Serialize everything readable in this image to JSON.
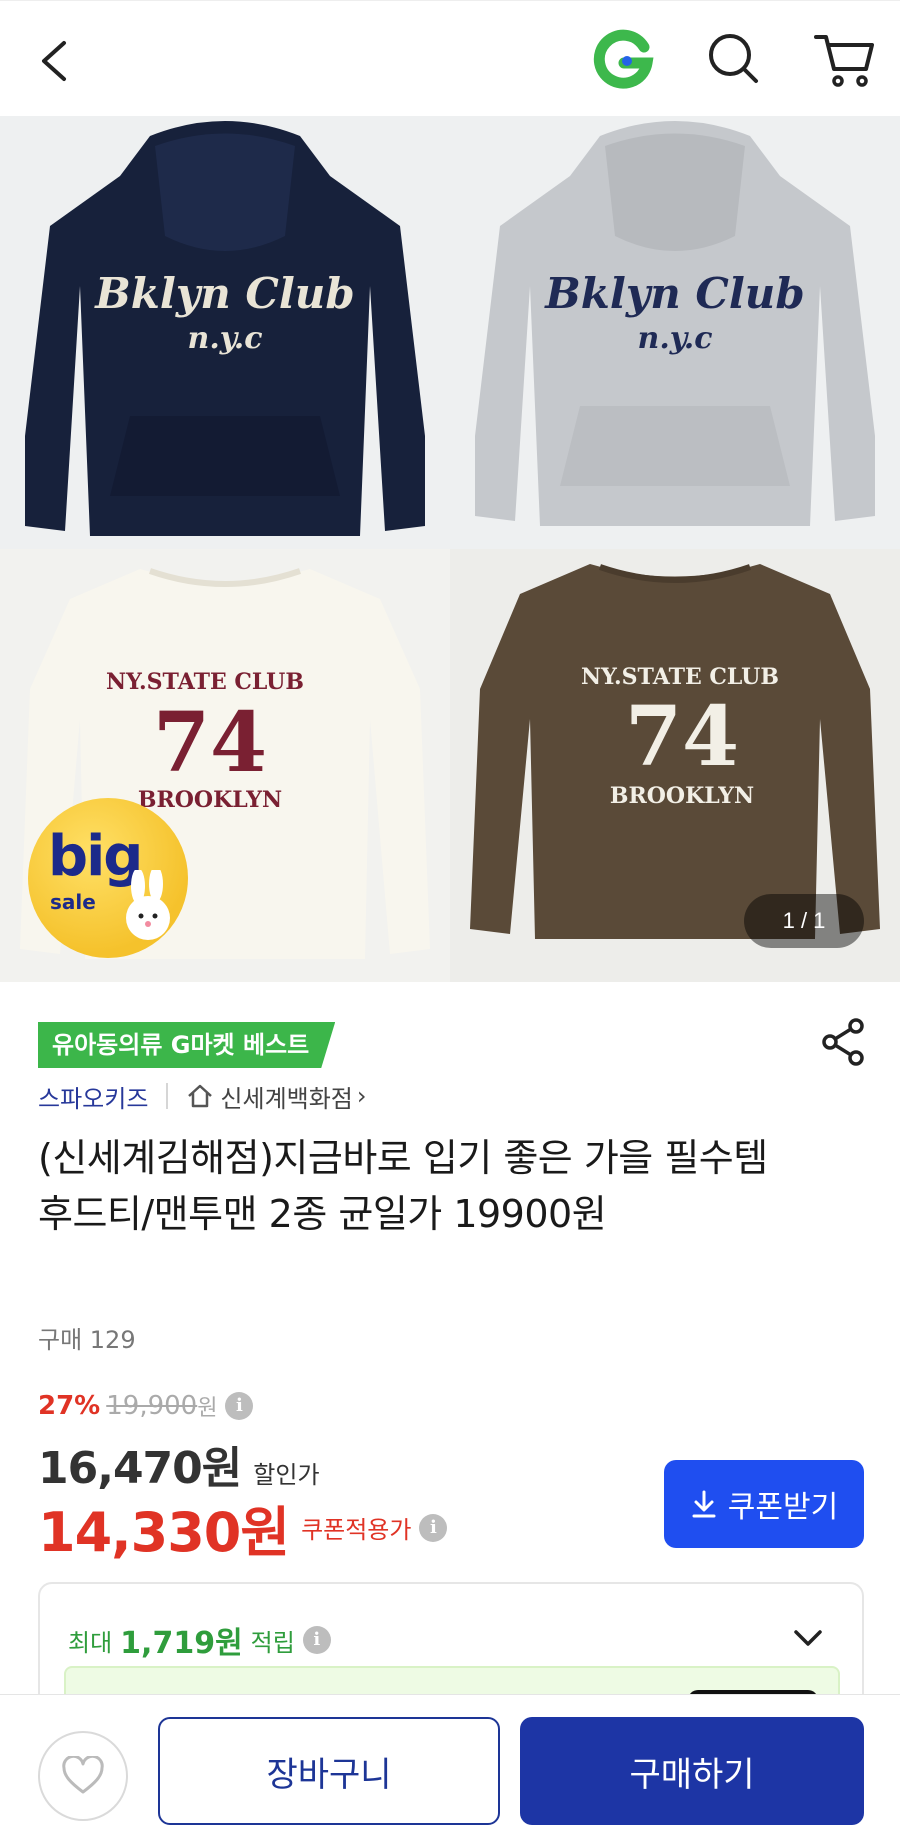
{
  "header": {
    "back_icon": "chevron-left-icon",
    "logo_icon": "gmarket-g-logo",
    "search_icon": "search-icon",
    "cart_icon": "cart-icon"
  },
  "gallery": {
    "counter": "1 / 1",
    "sale_sticker": {
      "big": "big",
      "sale": "sale"
    },
    "hoodie_print": {
      "line1": "Bklyn Club",
      "line2": "n.y.c"
    },
    "sweat_print": {
      "line1": "NY.STATE CLUB",
      "line2": "74",
      "line3": "BROOKLYN"
    }
  },
  "product": {
    "best_badge": "유아동의류 G마켓 베스트",
    "seller": "스파오키즈",
    "store": "신세계백화점",
    "store_chevron": "›",
    "title": "(신세계김해점)지금바로 입기 좋은 가을 필수템 후드티/맨투맨 2종 균일가 19900원",
    "sold_count": "구매 129"
  },
  "price": {
    "discount_rate": "27%",
    "original_price": "19,900",
    "original_unit": "원",
    "sale_price": "16,470원",
    "sale_label": "할인가",
    "coupon_price": "14,330원",
    "coupon_label": "쿠폰적용가",
    "coupon_button": "쿠폰받기",
    "info_glyph": "i"
  },
  "reward": {
    "prefix": "최대",
    "amount": "1,719원",
    "suffix": "적립"
  },
  "bottom_bar": {
    "cart_label": "장바구니",
    "buy_label": "구매하기"
  },
  "colors": {
    "accent_blue": "#1f4ef0",
    "buy_blue": "#1d35a5",
    "discount_red": "#e03325",
    "best_green": "#3cb64a",
    "reward_green": "#2f9d3c"
  }
}
